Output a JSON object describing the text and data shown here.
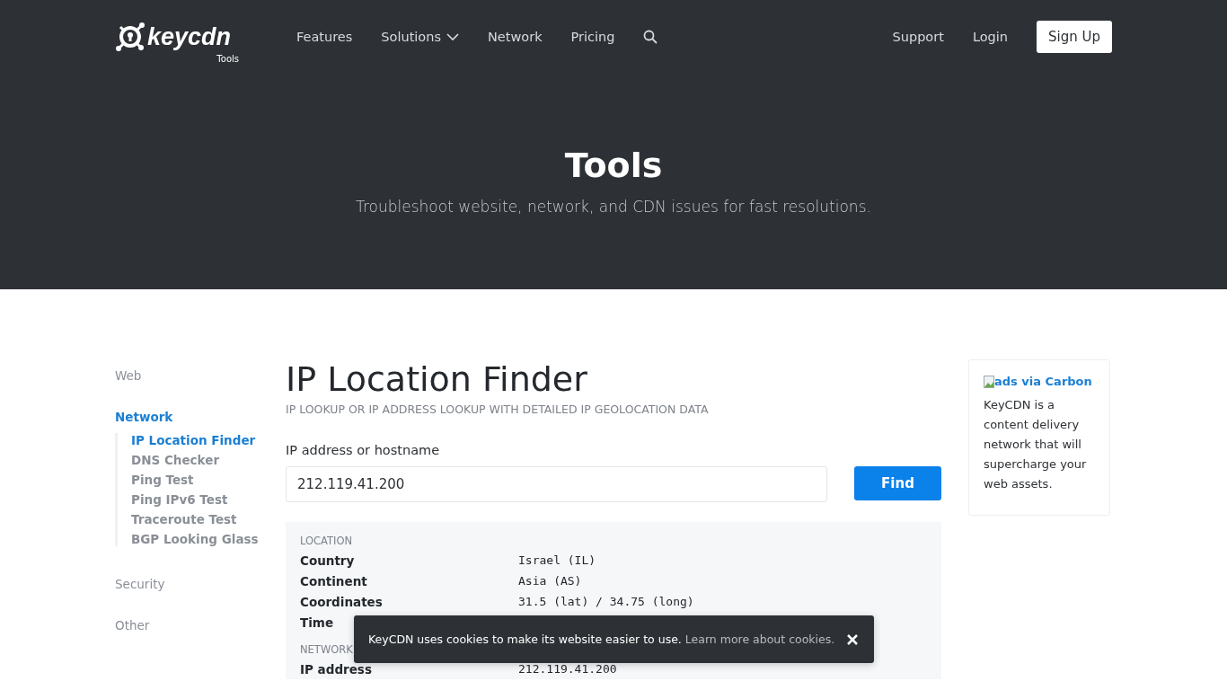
{
  "logo": {
    "word": "keycdn",
    "sub": "Tools"
  },
  "nav": [
    {
      "label": "Features",
      "dropdown": false
    },
    {
      "label": "Solutions",
      "dropdown": true
    },
    {
      "label": "Network",
      "dropdown": false
    },
    {
      "label": "Pricing",
      "dropdown": false
    }
  ],
  "nav_right": {
    "links": [
      "Support",
      "Login"
    ],
    "signup": "Sign Up"
  },
  "hero": {
    "title": "Tools",
    "subtitle": "Troubleshoot website, network, and CDN issues for fast resolutions."
  },
  "sidebar": [
    {
      "label": "Web",
      "selected": false
    },
    {
      "label": "Network",
      "selected": true,
      "children": [
        {
          "label": "IP Location Finder",
          "selected": true
        },
        {
          "label": "DNS Checker",
          "selected": false
        },
        {
          "label": "Ping Test",
          "selected": false
        },
        {
          "label": "Ping IPv6 Test",
          "selected": false
        },
        {
          "label": "Traceroute Test",
          "selected": false
        },
        {
          "label": "BGP Looking Glass",
          "selected": false
        }
      ]
    },
    {
      "label": "Security",
      "selected": false
    },
    {
      "label": "Other",
      "selected": false
    }
  ],
  "main": {
    "title": "IP Location Finder",
    "subtitle": "IP LOOKUP OR IP ADDRESS LOOKUP WITH DETAILED IP GEOLOCATION DATA",
    "field_label": "IP address or hostname",
    "field_value": "212.119.41.200",
    "button": "Find"
  },
  "results": [
    {
      "heading": "LOCATION",
      "rows": [
        {
          "label": "Country",
          "value": "Israel (IL)"
        },
        {
          "label": "Continent",
          "value": "Asia (AS)"
        },
        {
          "label": "Coordinates",
          "value": "31.5 (lat) / 34.75 (long)"
        },
        {
          "label": "Time"
        }
      ]
    },
    {
      "heading": "NETWORK",
      "rows": [
        {
          "label": "IP address",
          "value": "212.119.41.200"
        }
      ]
    }
  ],
  "ad": {
    "link": "ads via Carbon",
    "text": "KeyCDN is a content delivery network that will supercharge your web assets."
  },
  "cookie": {
    "text": "KeyCDN uses cookies to make its website easier to use.",
    "link": "Learn more about cookies."
  }
}
